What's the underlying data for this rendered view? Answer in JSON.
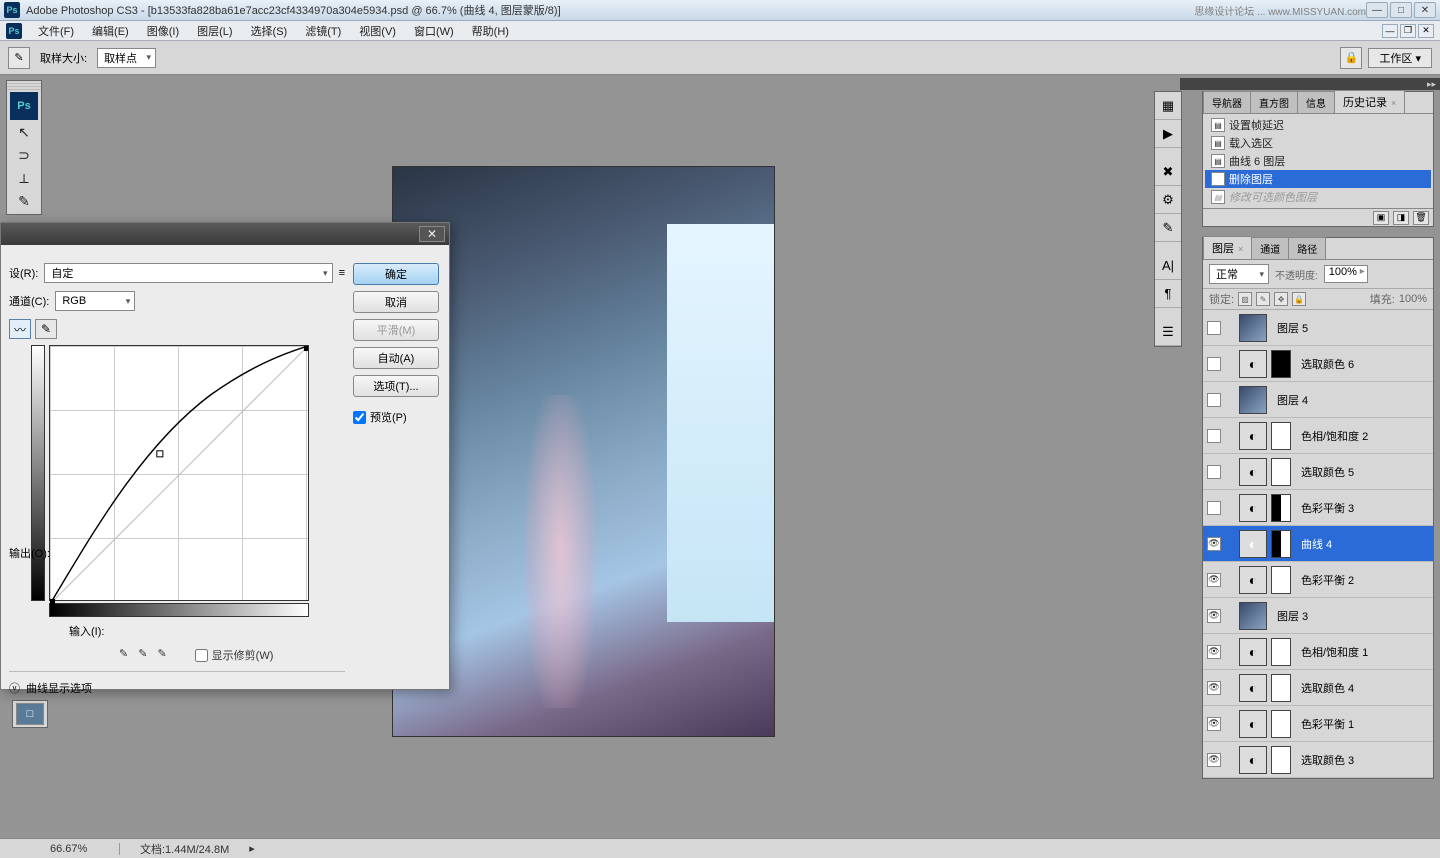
{
  "app_title": "Adobe Photoshop CS3 - [b13533fa828ba61e7acc23cf4334970a304e5934.psd @ 66.7% (曲线 4, 图层蒙版/8)]",
  "watermark": "思缘设计论坛 ... www.MISSYUAN.com",
  "menu": [
    "文件(F)",
    "编辑(E)",
    "图像(I)",
    "图层(L)",
    "选择(S)",
    "滤镜(T)",
    "视图(V)",
    "窗口(W)",
    "帮助(H)"
  ],
  "options": {
    "sample_size_label": "取样大小:",
    "sample_size_value": "取样点",
    "workspace_label": "工作区 ▾"
  },
  "curves": {
    "preset_label": "设(R):",
    "preset_value": "自定",
    "channel_label": "通道(C):",
    "channel_value": "RGB",
    "output_label": "输出(O):",
    "input_label": "输入(I):",
    "show_clipping": "显示修剪(W)",
    "expand": "曲线显示选项",
    "ok": "确定",
    "cancel": "取消",
    "smooth": "平滑(M)",
    "auto": "自动(A)",
    "options_btn": "选项(T)...",
    "preview": "预览(P)"
  },
  "history_panel": {
    "tabs": [
      "导航器",
      "直方图",
      "信息",
      "历史记录"
    ],
    "items": [
      {
        "label": "设置帧延迟",
        "sel": false
      },
      {
        "label": "载入选区",
        "sel": false
      },
      {
        "label": "曲线 6 图层",
        "sel": false
      },
      {
        "label": "删除图层",
        "sel": true
      },
      {
        "label": "修改可选颜色图层",
        "dim": true
      }
    ]
  },
  "layers_panel": {
    "tabs": [
      "图层",
      "通道",
      "路径"
    ],
    "blend_mode": "正常",
    "opacity_label": "不透明度:",
    "opacity": "100%",
    "lock_label": "锁定:",
    "fill_label": "填充:",
    "fill": "100%",
    "layers": [
      {
        "name": "图层 5",
        "type": "img",
        "vis": false
      },
      {
        "name": "选取颜色 6",
        "type": "adj",
        "mask": "dark",
        "vis": false
      },
      {
        "name": "图层 4",
        "type": "img",
        "vis": false
      },
      {
        "name": "色相/饱和度 2",
        "type": "adj",
        "mask": "white",
        "vis": false
      },
      {
        "name": "选取颜色 5",
        "type": "adj",
        "mask": "white",
        "vis": false
      },
      {
        "name": "色彩平衡 3",
        "type": "adj",
        "mask": "half",
        "vis": false
      },
      {
        "name": "曲线 4",
        "type": "adj",
        "mask": "half",
        "vis": true,
        "sel": true
      },
      {
        "name": "色彩平衡 2",
        "type": "adj",
        "mask": "white",
        "vis": true
      },
      {
        "name": "图层 3",
        "type": "img",
        "vis": true
      },
      {
        "name": "色相/饱和度 1",
        "type": "adj",
        "mask": "white",
        "vis": true
      },
      {
        "name": "选取颜色 4",
        "type": "adj",
        "mask": "white",
        "vis": true
      },
      {
        "name": "色彩平衡 1",
        "type": "adj",
        "mask": "white",
        "vis": true
      },
      {
        "name": "选取颜色 3",
        "type": "adj",
        "mask": "white",
        "vis": true
      }
    ]
  },
  "status": {
    "zoom": "66.67%",
    "doc": "文档:1.44M/24.8M"
  }
}
